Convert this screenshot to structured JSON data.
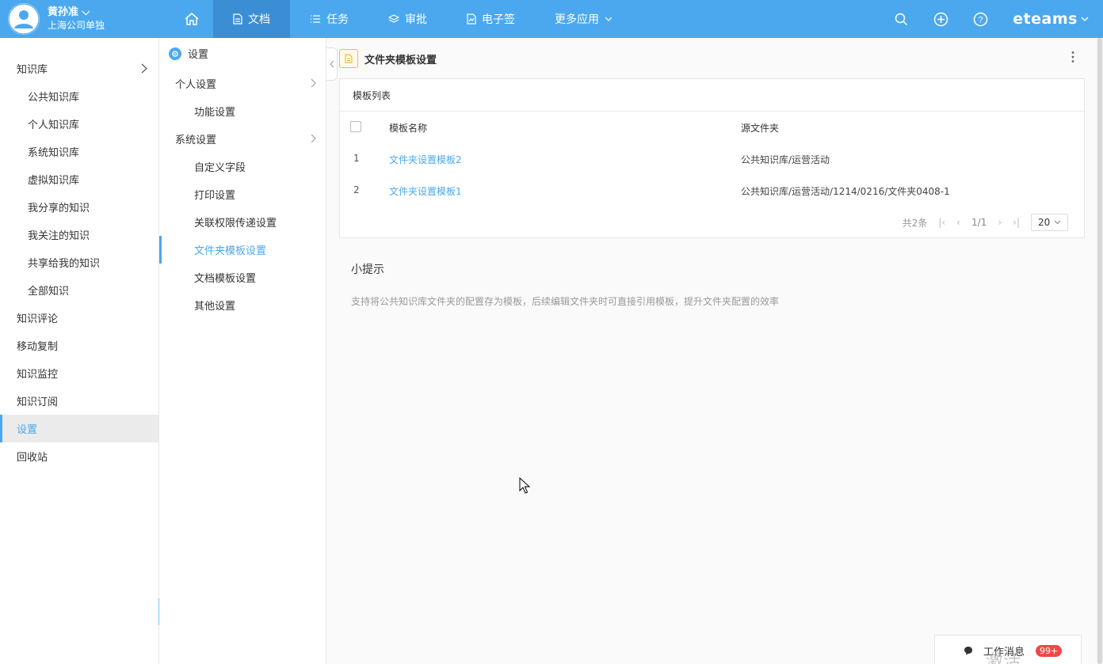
{
  "user": {
    "name": "黄孙准",
    "company": "上海公司单独"
  },
  "nav": {
    "items": [
      {
        "label": "文档",
        "icon": "document-icon",
        "active": true
      },
      {
        "label": "任务",
        "icon": "list-icon"
      },
      {
        "label": "审批",
        "icon": "layers-icon"
      },
      {
        "label": "电子签",
        "icon": "sign-icon"
      },
      {
        "label": "更多应用",
        "icon": "chevron-down-icon"
      }
    ],
    "brand": "eteams"
  },
  "sidebar": {
    "items": [
      {
        "label": "知识库",
        "level": 1
      },
      {
        "label": "公共知识库",
        "level": 2
      },
      {
        "label": "个人知识库",
        "level": 2
      },
      {
        "label": "系统知识库",
        "level": 2
      },
      {
        "label": "虚拟知识库",
        "level": 2
      },
      {
        "label": "我分享的知识",
        "level": 2
      },
      {
        "label": "我关注的知识",
        "level": 2
      },
      {
        "label": "共享给我的知识",
        "level": 2
      },
      {
        "label": "全部知识",
        "level": 2
      },
      {
        "label": "知识评论",
        "level": 1
      },
      {
        "label": "移动复制",
        "level": 1
      },
      {
        "label": "知识监控",
        "level": 1
      },
      {
        "label": "知识订阅",
        "level": 1
      },
      {
        "label": "设置",
        "level": 1,
        "active": true
      },
      {
        "label": "回收站",
        "level": 1
      }
    ]
  },
  "settings": {
    "title": "设置",
    "items": [
      {
        "label": "个人设置",
        "group": true
      },
      {
        "label": "功能设置"
      },
      {
        "label": "系统设置",
        "group": true
      },
      {
        "label": "自定义字段"
      },
      {
        "label": "打印设置"
      },
      {
        "label": "关联权限传递设置"
      },
      {
        "label": "文件夹模板设置",
        "active": true
      },
      {
        "label": "文档模板设置"
      },
      {
        "label": "其他设置"
      }
    ]
  },
  "main": {
    "title": "文件夹模板设置",
    "panel_title": "模板列表",
    "columns": {
      "name": "模板名称",
      "source": "源文件夹"
    },
    "rows": [
      {
        "index": "1",
        "name": "文件夹设置模板2",
        "source": "公共知识库/运营活动"
      },
      {
        "index": "2",
        "name": "文件夹设置模板1",
        "source": "公共知识库/运营活动/1214/0216/文件夹0408-1"
      }
    ],
    "pager": {
      "total": "共2条",
      "page": "1/1",
      "size": "20"
    },
    "tips_title": "小提示",
    "tips_text": "支持将公共知识库文件夹的配置存为模板，后续编辑文件夹时可直接引用模板，提升文件夹配置的效率"
  },
  "messages": {
    "label": "工作消息",
    "badge": "99+"
  },
  "watermark": "激活 Windows",
  "colors": {
    "accent": "#4ba8ee",
    "nav_active": "#3b8ed3",
    "badge": "#f04848"
  }
}
